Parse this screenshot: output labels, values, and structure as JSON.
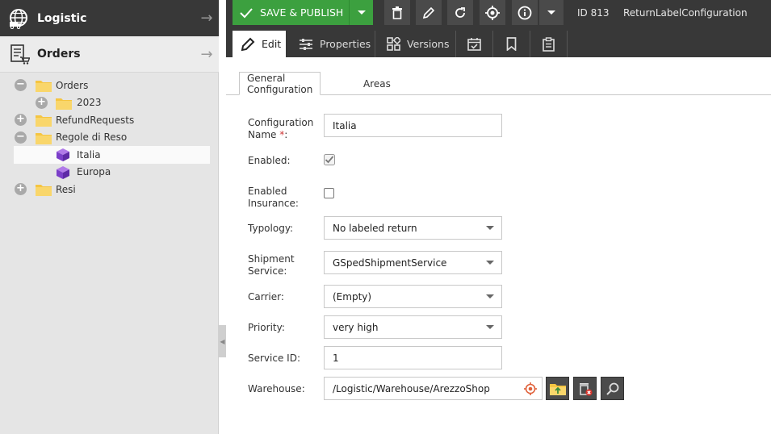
{
  "sidebar": {
    "panels": [
      {
        "title": "Logistic"
      },
      {
        "title": "Orders"
      }
    ],
    "tree": [
      {
        "label": "Orders"
      },
      {
        "label": "2023"
      },
      {
        "label": "RefundRequests"
      },
      {
        "label": "Regole di Reso"
      },
      {
        "label": "Italia"
      },
      {
        "label": "Europa"
      },
      {
        "label": "Resi"
      }
    ]
  },
  "toolbar": {
    "save_label": "SAVE & PUBLISH",
    "id_label": "ID 813",
    "class_label": "ReturnLabelConfiguration"
  },
  "tabs": [
    {
      "label": "Edit"
    },
    {
      "label": "Properties"
    },
    {
      "label": "Versions"
    }
  ],
  "subtabs": [
    {
      "label": "General Configuration"
    },
    {
      "label": "Areas"
    }
  ],
  "form": {
    "config_name": {
      "label": "Configuration Name",
      "required_mark": "*",
      "label_suffix": ":",
      "value": "Italia"
    },
    "enabled": {
      "label": "Enabled:",
      "checked": true
    },
    "enabled_insurance": {
      "label": "Enabled Insurance:",
      "checked": false
    },
    "typology": {
      "label": "Typology:",
      "value": "No labeled return"
    },
    "shipment_service": {
      "label": "Shipment Service:",
      "value": "GSpedShipmentService"
    },
    "carrier": {
      "label": "Carrier:",
      "value": "(Empty)"
    },
    "priority": {
      "label": "Priority:",
      "value": "very high"
    },
    "service_id": {
      "label": "Service ID:",
      "value": "1"
    },
    "warehouse": {
      "label": "Warehouse:",
      "value": "/Logistic/Warehouse/ArezzoShop"
    }
  },
  "colors": {
    "accent_green": "#3ca03f",
    "dark_bar": "#383838",
    "folder": "#f5c542",
    "cube": "#8a4fd6"
  }
}
